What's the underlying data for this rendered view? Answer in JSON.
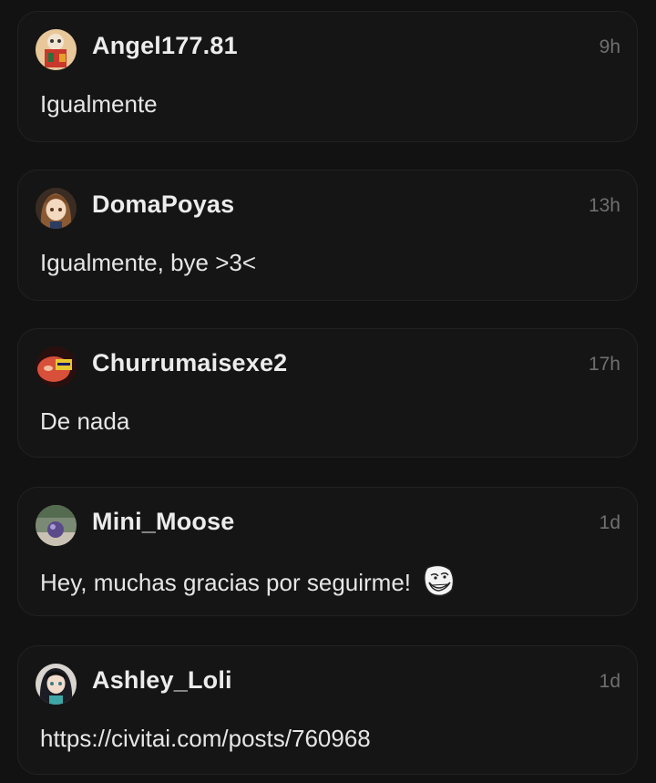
{
  "comments": [
    {
      "username": "Angel177.81",
      "time": "9h",
      "message": "Igualmente",
      "avatar_icon": "user-avatar-icon"
    },
    {
      "username": "DomaPoyas",
      "time": "13h",
      "message": "Igualmente, bye >3<",
      "avatar_icon": "user-avatar-icon"
    },
    {
      "username": "Churrumaisexe2",
      "time": "17h",
      "message": "De nada",
      "avatar_icon": "user-avatar-icon"
    },
    {
      "username": "Mini_Moose",
      "time": "1d",
      "message": "Hey, muchas gracias por seguirme!",
      "emoji_icon": "troll-face-emoji-icon",
      "avatar_icon": "user-avatar-icon"
    },
    {
      "username": "Ashley_Loli",
      "time": "1d",
      "message": "https://civitai.com/posts/760968",
      "avatar_icon": "user-avatar-icon"
    }
  ]
}
